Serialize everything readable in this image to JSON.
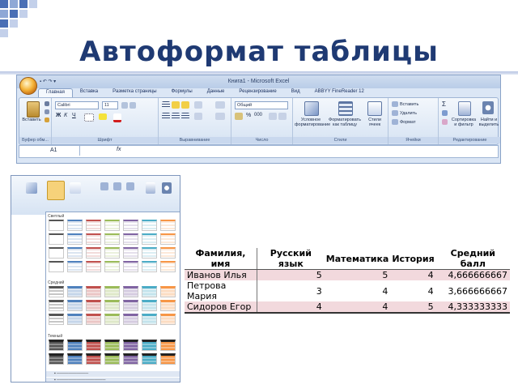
{
  "slide": {
    "title": "Автоформат таблицы"
  },
  "ribbon": {
    "window_title": "Книга1 - Microsoft Excel",
    "tabs": [
      "Главная",
      "Вставка",
      "Разметка страницы",
      "Формулы",
      "Данные",
      "Рецензирование",
      "Вид",
      "ABBYY FineReader 12"
    ],
    "font_name": "Calibri",
    "font_size": "11",
    "number_format": "Общий",
    "name_box": "A1",
    "formula_symbol": "fx",
    "buttons": {
      "paste": "Вставить",
      "conditional": "Условное форматирование",
      "format_table": "Форматировать как таблицу",
      "cell_styles": "Стили ячеек",
      "insert": "Вставить",
      "delete": "Удалить",
      "format": "Формат",
      "sort": "Сортировка и фильтр",
      "find": "Найти и выделить"
    },
    "groups": [
      "Буфер обм...",
      "Шрифт",
      "Выравнивание",
      "Число",
      "Стили",
      "Ячейки",
      "Редактирование"
    ]
  },
  "gallery": {
    "sections": [
      "Светлый",
      "Средний",
      "Темный"
    ]
  },
  "students_table": {
    "headers": [
      "Фамилия, имя",
      "Русский язык",
      "Математика",
      "История",
      "Средний балл"
    ],
    "rows": [
      [
        "Иванов Илья",
        "5",
        "5",
        "4",
        "4,666666667"
      ],
      [
        "Петрова Мария",
        "3",
        "4",
        "4",
        "3,666666667"
      ],
      [
        "Сидоров Егор",
        "4",
        "4",
        "5",
        "4,333333333"
      ]
    ]
  },
  "colors": {
    "title": "#1f3a73",
    "row_highlight": "#f2d9dd",
    "ribbon_bg": "#dbe6f5"
  }
}
